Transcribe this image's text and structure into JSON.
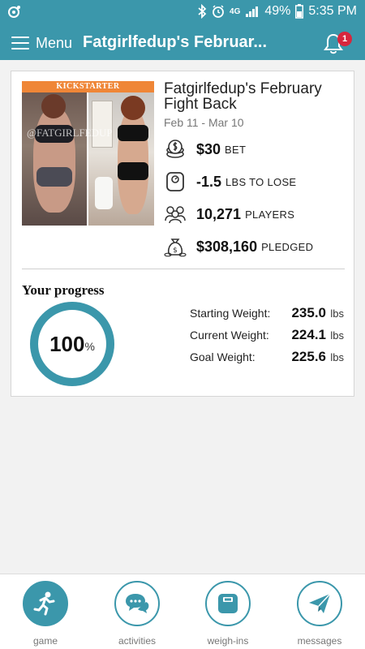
{
  "status_bar": {
    "battery_percent": "49%",
    "time": "5:35 PM",
    "network": "4G"
  },
  "header": {
    "menu_label": "Menu",
    "title": "Fatgirlfedup's Februar...",
    "notification_count": "1"
  },
  "game": {
    "image_banner": "KICKSTARTER",
    "image_watermark": "@FATGIRLFEDUP",
    "title": "Fatgirlfedup's February Fight Back",
    "dates": "Feb 11 - Mar 10",
    "stats": [
      {
        "icon": "coin-stack-icon",
        "value": "$30",
        "unit": "BET"
      },
      {
        "icon": "scale-icon",
        "value": "-1.5",
        "unit": "LBS TO LOSE"
      },
      {
        "icon": "players-icon",
        "value": "10,271",
        "unit": "PLAYERS"
      },
      {
        "icon": "money-bag-icon",
        "value": "$308,160",
        "unit": "PLEDGED"
      }
    ]
  },
  "progress": {
    "title": "Your progress",
    "percent": "100",
    "percent_symbol": "%",
    "percent_value": 100,
    "ring_color": "#3b97ab",
    "weights": [
      {
        "label": "Starting Weight:",
        "value": "235.0",
        "unit": "lbs"
      },
      {
        "label": "Current Weight:",
        "value": "224.1",
        "unit": "lbs"
      },
      {
        "label": "Goal Weight:",
        "value": "225.6",
        "unit": "lbs"
      }
    ]
  },
  "nav": {
    "items": [
      {
        "label": "game",
        "icon": "runner-icon",
        "active": true
      },
      {
        "label": "activities",
        "icon": "chat-bubbles-icon",
        "active": false
      },
      {
        "label": "weigh-ins",
        "icon": "scale-icon",
        "active": false
      },
      {
        "label": "messages",
        "icon": "paper-plane-icon",
        "active": false
      }
    ]
  },
  "colors": {
    "accent": "#3b97ab",
    "badge": "#d7263d",
    "banner": "#ef8637"
  }
}
